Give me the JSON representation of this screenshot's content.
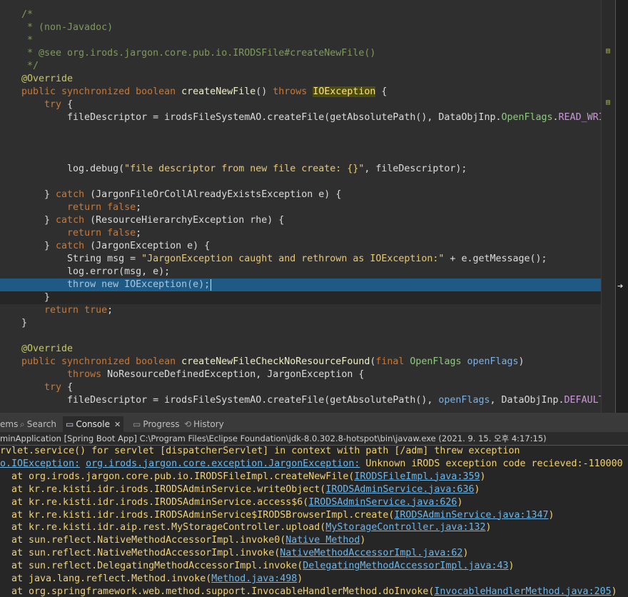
{
  "editor": {
    "lines": [
      [
        [
          "/*",
          "#7e9a5c"
        ]
      ],
      [
        [
          " * (non-Javadoc)",
          "#7e9a5c"
        ]
      ],
      [
        [
          " *",
          "#7e9a5c"
        ]
      ],
      [
        [
          " * @see org.irods.jargon.core.pub.io.IRODSFile#createNewFile()",
          "#7e9a5c"
        ]
      ],
      [
        [
          " */",
          "#7e9a5c"
        ]
      ],
      [
        [
          "@Override",
          "#c8c866"
        ]
      ],
      [
        [
          "public synchronized boolean ",
          "#cc7832"
        ],
        [
          "createNewFile",
          "#f0f0c8"
        ],
        [
          "() ",
          "#dcdcdc"
        ],
        [
          "throws",
          "#cc7832"
        ],
        [
          " ",
          "#dcdcdc"
        ],
        [
          "IOException",
          "#ffe08a",
          "#4d4d0b"
        ],
        [
          " {",
          "#dcdcdc"
        ]
      ],
      [
        [
          "    ",
          "#dcdcdc"
        ],
        [
          "try",
          "#cc7832"
        ],
        [
          " {",
          "#dcdcdc"
        ]
      ],
      [
        [
          "        fileDescriptor = irodsFileSystemAO.createFile(getAbsolutePath(), DataObjInp.",
          "#dcdcdc"
        ],
        [
          "OpenFlags",
          "#8fc980"
        ],
        [
          ".",
          "#dcdcdc"
        ],
        [
          "READ_WRITE",
          "#c89ad6"
        ]
      ],
      [],
      [],
      [],
      [
        [
          "        log.debug(",
          "#dcdcdc"
        ],
        [
          "\"file descriptor from new file create: {}\"",
          "#e6c87a"
        ],
        [
          ", fileDescriptor);",
          "#dcdcdc"
        ]
      ],
      [],
      [
        [
          "    } ",
          "#dcdcdc"
        ],
        [
          "catch",
          "#cc7832"
        ],
        [
          " (JargonFileOrCollAlreadyExistsException e) {",
          "#dcdcdc"
        ]
      ],
      [
        [
          "        ",
          "#dcdcdc"
        ],
        [
          "return false",
          "#cc7832"
        ],
        [
          ";",
          "#dcdcdc"
        ]
      ],
      [
        [
          "    } ",
          "#dcdcdc"
        ],
        [
          "catch",
          "#cc7832"
        ],
        [
          " (ResourceHierarchyException rhe) {",
          "#dcdcdc"
        ]
      ],
      [
        [
          "        ",
          "#dcdcdc"
        ],
        [
          "return false",
          "#cc7832"
        ],
        [
          ";",
          "#dcdcdc"
        ]
      ],
      [
        [
          "    } ",
          "#dcdcdc"
        ],
        [
          "catch",
          "#cc7832"
        ],
        [
          " (JargonException e) {",
          "#dcdcdc"
        ]
      ],
      [
        [
          "        String msg = ",
          "#dcdcdc"
        ],
        [
          "\"JargonException caught and rethrown as IOException:\"",
          "#e6c87a"
        ],
        [
          " + e.getMessage();",
          "#dcdcdc"
        ]
      ],
      [
        [
          "        log.error(msg, e);",
          "#dcdcdc"
        ]
      ],
      [
        [
          "        throw new IOException(e);",
          "#dcdcdc"
        ]
      ],
      [
        [
          "    }",
          "#dcdcdc"
        ]
      ],
      [
        [
          "    ",
          "#dcdcdc"
        ],
        [
          "return true",
          "#cc7832"
        ],
        [
          ";",
          "#dcdcdc"
        ]
      ],
      [
        [
          "}",
          "#dcdcdc"
        ]
      ],
      [],
      [
        [
          "@Override",
          "#c8c866"
        ]
      ],
      [
        [
          "public synchronized boolean ",
          "#cc7832"
        ],
        [
          "createNewFileCheckNoResourceFound",
          "#f0f0c8"
        ],
        [
          "(",
          "#dcdcdc"
        ],
        [
          "final",
          "#cc7832"
        ],
        [
          " ",
          "#dcdcdc"
        ],
        [
          "OpenFlags",
          "#8fc980"
        ],
        [
          " ",
          "#dcdcdc"
        ],
        [
          "openFlags",
          "#7fb0e0"
        ],
        [
          ")",
          "#dcdcdc"
        ]
      ],
      [
        [
          "        ",
          "#dcdcdc"
        ],
        [
          "throws",
          "#cc7832"
        ],
        [
          " NoResourceDefinedException, JargonException {",
          "#dcdcdc"
        ]
      ],
      [
        [
          "    ",
          "#dcdcdc"
        ],
        [
          "try",
          "#cc7832"
        ],
        [
          " {",
          "#dcdcdc"
        ]
      ],
      [
        [
          "        fileDescriptor = irodsFileSystemAO.createFile(getAbsolutePath(), ",
          "#dcdcdc"
        ],
        [
          "openFlags",
          "#7fb0e0"
        ],
        [
          ", DataObjInp.",
          "#dcdcdc"
        ],
        [
          "DEFAULT",
          "#c89ad6"
        ]
      ]
    ]
  },
  "tabs": [
    {
      "label": "ems",
      "icon": "≡",
      "active": false
    },
    {
      "label": "Search",
      "icon": "🔍",
      "active": false
    },
    {
      "label": "Console",
      "icon": "▭",
      "active": true
    },
    {
      "label": "Progress",
      "icon": "▭",
      "active": false
    },
    {
      "label": "History",
      "icon": "⟲",
      "active": false
    }
  ],
  "launch_text": "minApplication [Spring Boot App] C:\\Program Files\\Eclipse Foundation\\jdk-8.0.302.8-hotspot\\bin\\javaw.exe  (2021. 9. 15. 오후 4:17:15)",
  "console_lines": [
    [
      [
        "rvlet.service() for servlet [dispatcherServlet] in context with path [/adm] threw exception",
        null
      ]
    ],
    [
      [
        "o.IOException:",
        "link"
      ],
      [
        " ",
        null
      ],
      [
        "org.irods.jargon.core.exception.JargonException:",
        "link"
      ],
      [
        " Unknown iRODS exception code recieved:-110000",
        null
      ]
    ],
    [
      [
        "  at org.irods.jargon.core.pub.io.IRODSFileImpl.createNewFile(",
        null
      ],
      [
        "IRODSFileImpl.java:359",
        "link"
      ],
      [
        ")",
        null
      ]
    ],
    [
      [
        "  at kr.re.kisti.idr.irods.IRODSAdminService.writeObject(",
        null
      ],
      [
        "IRODSAdminService.java:636",
        "link"
      ],
      [
        ")",
        null
      ]
    ],
    [
      [
        "  at kr.re.kisti.idr.irods.IRODSAdminService.access$6(",
        null
      ],
      [
        "IRODSAdminService.java:626",
        "link"
      ],
      [
        ")",
        null
      ]
    ],
    [
      [
        "  at kr.re.kisti.idr.irods.IRODSAdminService$IRODSBrowserImpl.create(",
        null
      ],
      [
        "IRODSAdminService.java:1347",
        "link"
      ],
      [
        ")",
        null
      ]
    ],
    [
      [
        "  at kr.re.kisti.idr.aip.rest.MyStorageController.upload(",
        null
      ],
      [
        "MyStorageController.java:132",
        "link"
      ],
      [
        ")",
        null
      ]
    ],
    [
      [
        "  at sun.reflect.NativeMethodAccessorImpl.invoke0(",
        null
      ],
      [
        "Native Method",
        "link"
      ],
      [
        ")",
        null
      ]
    ],
    [
      [
        "  at sun.reflect.NativeMethodAccessorImpl.invoke(",
        null
      ],
      [
        "NativeMethodAccessorImpl.java:62",
        "link"
      ],
      [
        ")",
        null
      ]
    ],
    [
      [
        "  at sun.reflect.DelegatingMethodAccessorImpl.invoke(",
        null
      ],
      [
        "DelegatingMethodAccessorImpl.java:43",
        "link"
      ],
      [
        ")",
        null
      ]
    ],
    [
      [
        "  at java.lang.reflect.Method.invoke(",
        null
      ],
      [
        "Method.java:498",
        "link"
      ],
      [
        ")",
        null
      ]
    ],
    [
      [
        "  at org.springframework.web.method.support.InvocableHandlerMethod.doInvoke(",
        null
      ],
      [
        "InvocableHandlerMethod.java:205",
        "link"
      ],
      [
        ")",
        null
      ]
    ]
  ],
  "ruler_marks": [
    "▤",
    "▤"
  ],
  "overview_marker": "➔",
  "colors": {
    "comment": "#7e9a5c",
    "keyword": "#cc7832",
    "string": "#e6c87a",
    "console_text": "#f0d27a",
    "console_link": "#6fb7e8",
    "selection": "#1f5a85"
  }
}
